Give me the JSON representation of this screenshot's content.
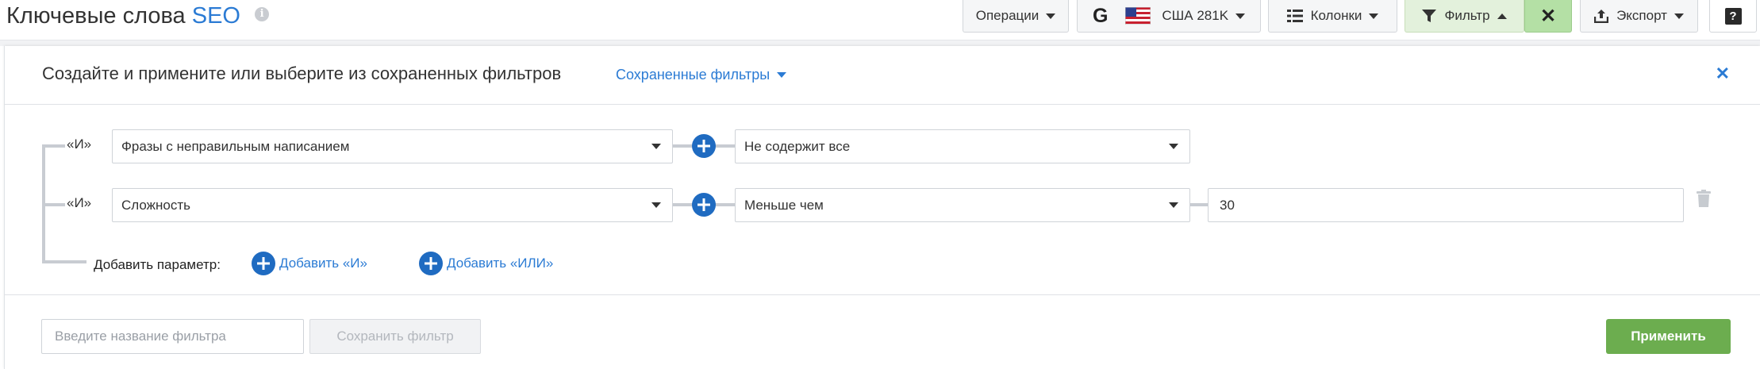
{
  "header": {
    "title_main": "Ключевые слова",
    "title_accent": "SEO",
    "info_glyph": "i"
  },
  "toolbar": {
    "operations_label": "Операции",
    "google_glyph": "G",
    "database_label": "США 281K",
    "columns_label": "Колонки",
    "filter_label": "Фильтр",
    "filter_close_glyph": "✕",
    "export_label": "Экспорт",
    "help_glyph": "?"
  },
  "filter_panel": {
    "title": "Создайте и примените или выберите из сохраненных фильтров",
    "saved_filters_label": "Сохраненные фильтры",
    "close_glyph": "✕",
    "rules": [
      {
        "logic": "«И»",
        "field": "Фразы с неправильным написанием",
        "operator": "Не содержит все",
        "value": null
      },
      {
        "logic": "«И»",
        "field": "Сложность",
        "operator": "Меньше чем",
        "value": "30"
      }
    ],
    "add_param_label": "Добавить параметр:",
    "add_and_label": "Добавить «И»",
    "add_or_label": "Добавить «ИЛИ»",
    "filter_name_placeholder": "Введите название фильтра",
    "save_filter_label": "Сохранить фильтр",
    "apply_label": "Применить"
  },
  "colors": {
    "accent_blue": "#2b7bd4",
    "plus_blue": "#1f6bc1",
    "apply_green": "#6cad4f",
    "filter_active_bg": "#e3f1dc",
    "filter_close_bg": "#b4e0a5"
  },
  "icons": [
    "info-icon",
    "caret-down-icon",
    "google-icon",
    "us-flag-icon",
    "columns-icon",
    "filter-icon",
    "caret-up-icon",
    "close-icon",
    "export-icon",
    "help-icon",
    "plus-circle-icon",
    "trash-icon"
  ]
}
